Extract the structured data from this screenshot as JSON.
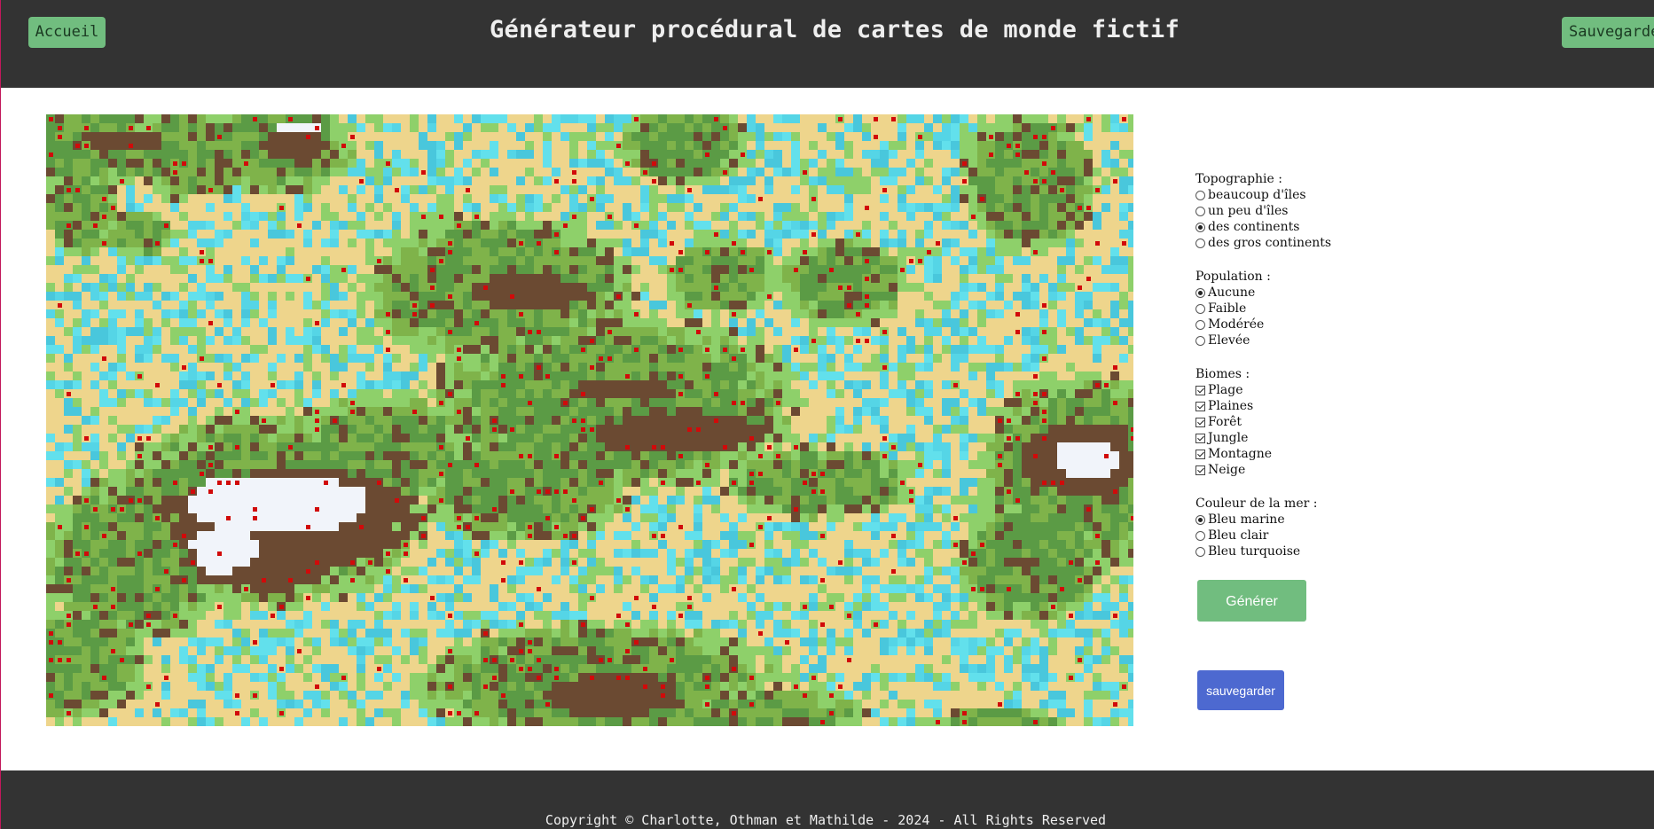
{
  "header": {
    "home_label": "Accueil",
    "title": "Générateur procédural de cartes de monde fictif",
    "save_label": "Sauvegarder"
  },
  "map": {
    "palette": {
      "sea_deep": "#49c7dc",
      "sea": "#55d5e6",
      "sea_light": "#62e0ec",
      "sand": "#eed58c",
      "plains": "#8ed06a",
      "forest": "#7fb34a",
      "jungle": "#5b9b45",
      "mountain": "#6b4a32",
      "snow": "#f1f4fa",
      "village": "#d10a0a"
    }
  },
  "controls": {
    "topography": {
      "label": "Topographie :",
      "options": [
        {
          "label": "beaucoup d'îles",
          "checked": false
        },
        {
          "label": "un peu d'îles",
          "checked": false
        },
        {
          "label": "des continents",
          "checked": true
        },
        {
          "label": "des gros continents",
          "checked": false
        }
      ]
    },
    "population": {
      "label": "Population :",
      "options": [
        {
          "label": "Aucune",
          "checked": true
        },
        {
          "label": "Faible",
          "checked": false
        },
        {
          "label": "Modérée",
          "checked": false
        },
        {
          "label": "Elevée",
          "checked": false
        }
      ]
    },
    "biomes": {
      "label": "Biomes :",
      "options": [
        {
          "label": "Plage",
          "checked": true
        },
        {
          "label": "Plaines",
          "checked": true
        },
        {
          "label": "Forêt",
          "checked": true
        },
        {
          "label": "Jungle",
          "checked": true
        },
        {
          "label": "Montagne",
          "checked": true
        },
        {
          "label": "Neige",
          "checked": true
        }
      ]
    },
    "sea_color": {
      "label": "Couleur de la mer :",
      "options": [
        {
          "label": "Bleu marine",
          "checked": true
        },
        {
          "label": "Bleu clair",
          "checked": false
        },
        {
          "label": "Bleu turquoise",
          "checked": false
        }
      ]
    },
    "generate_label": "Générer",
    "save_label": "sauvegarder"
  },
  "footer": {
    "copyright": "Copyright © Charlotte, Othman et Mathilde - 2024 - All Rights Reserved"
  }
}
